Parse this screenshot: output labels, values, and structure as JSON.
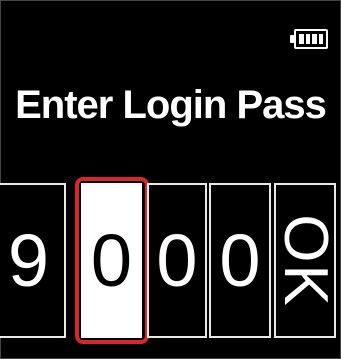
{
  "status": {
    "battery_icon": "battery-full-icon",
    "battery_level": 1.0
  },
  "title": "Enter Login Pass",
  "digits": [
    "9",
    "0",
    "0",
    "0"
  ],
  "active_digit_index": 1,
  "ok_label": "OK",
  "colors": {
    "background": "#000000",
    "text": "#ffffff",
    "highlight": "#d8262b",
    "active_fill": "#ffffff"
  }
}
